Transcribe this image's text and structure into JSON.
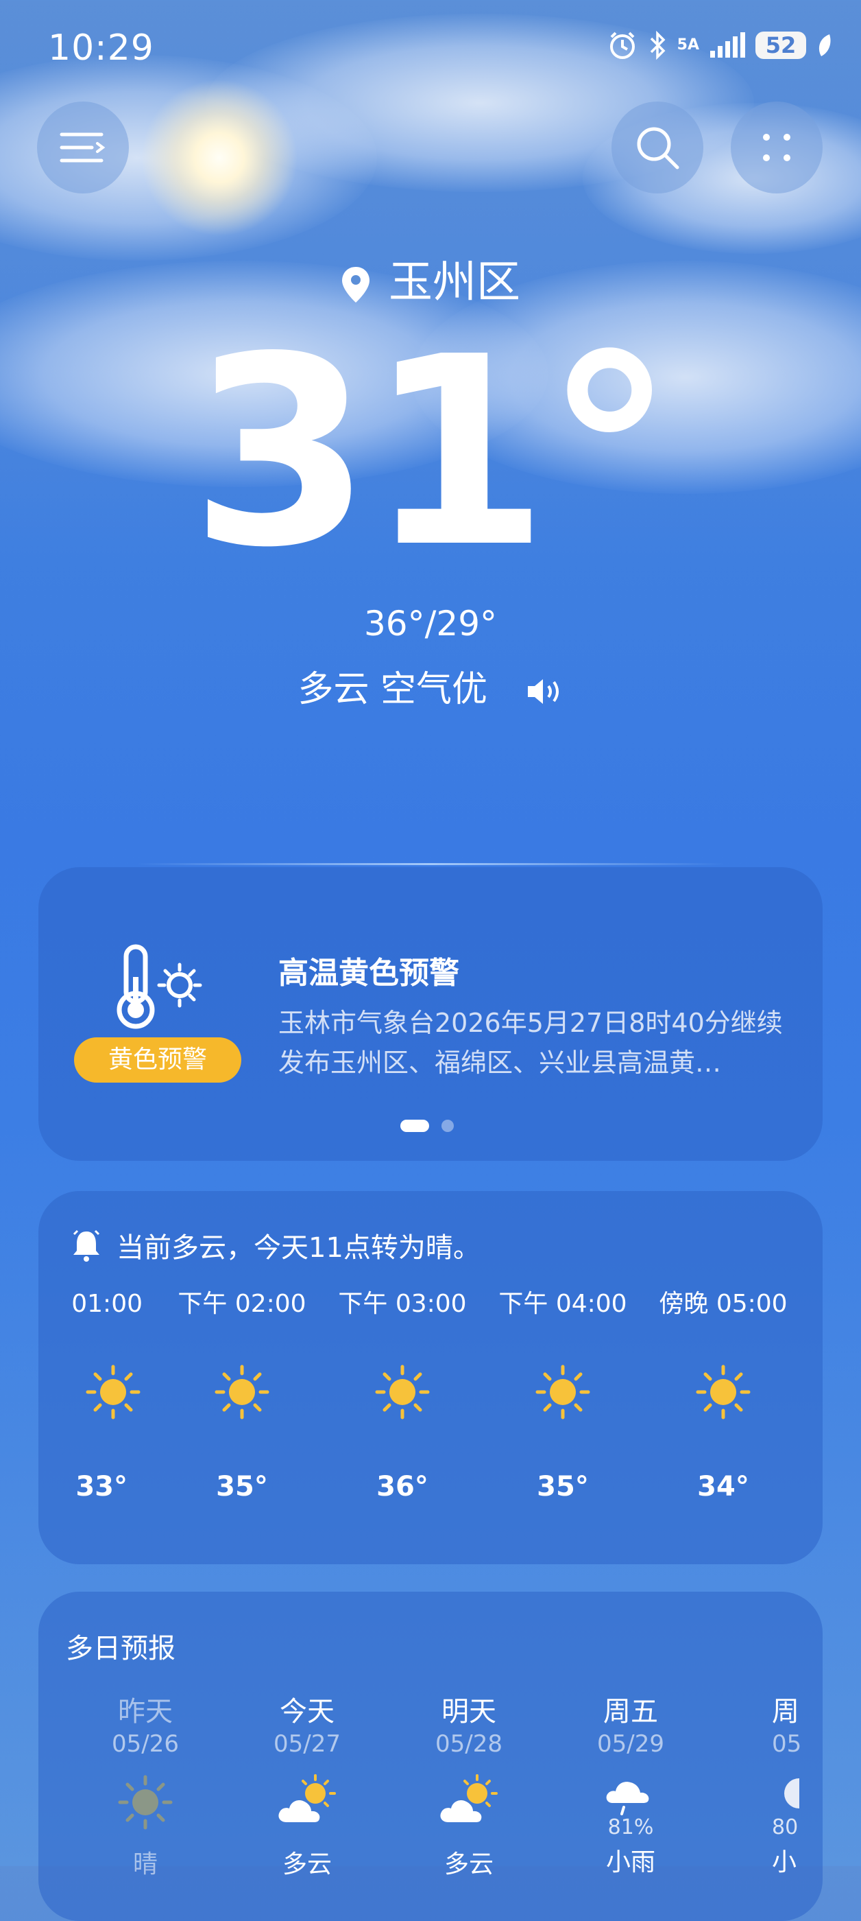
{
  "status": {
    "time": "10:29",
    "battery": "52",
    "network": "5A"
  },
  "header": {
    "location": "玉州区"
  },
  "current": {
    "temp": "31°",
    "hilo": "36°/29°",
    "condition": "多云 空气优"
  },
  "warning": {
    "badge": "黄色预警",
    "title": "高温黄色预警",
    "text": "玉林市气象台2026年5月27日8时40分继续发布玉州区、福绵区、兴业县高温黄…"
  },
  "hourly": {
    "summary": "当前多云，今天11点转为晴。",
    "items": [
      {
        "time": "01:00",
        "temp": "33°",
        "icon": "sun-icon"
      },
      {
        "time": "下午 02:00",
        "temp": "35°",
        "icon": "sun-icon"
      },
      {
        "time": "下午 03:00",
        "temp": "36°",
        "icon": "sun-icon"
      },
      {
        "time": "下午 04:00",
        "temp": "35°",
        "icon": "sun-icon"
      },
      {
        "time": "傍晚 05:00",
        "temp": "34°",
        "icon": "sun-icon"
      }
    ]
  },
  "daily": {
    "title": "多日预报",
    "items": [
      {
        "name": "昨天",
        "date": "05/26",
        "icon": "sun-icon",
        "weather": "晴",
        "pct": ""
      },
      {
        "name": "今天",
        "date": "05/27",
        "icon": "partly-cloudy-icon",
        "weather": "多云",
        "pct": ""
      },
      {
        "name": "明天",
        "date": "05/28",
        "icon": "partly-cloudy-icon",
        "weather": "多云",
        "pct": ""
      },
      {
        "name": "周五",
        "date": "05/29",
        "icon": "rain-cloud-icon",
        "weather": "小雨",
        "pct": "81%"
      },
      {
        "name": "周",
        "date": "05",
        "icon": "moon-icon",
        "weather": "小",
        "pct": "80"
      }
    ]
  },
  "colors": {
    "sun": "#f7c23a",
    "warning_badge": "#f6b82b",
    "card": "#2d64c8"
  }
}
